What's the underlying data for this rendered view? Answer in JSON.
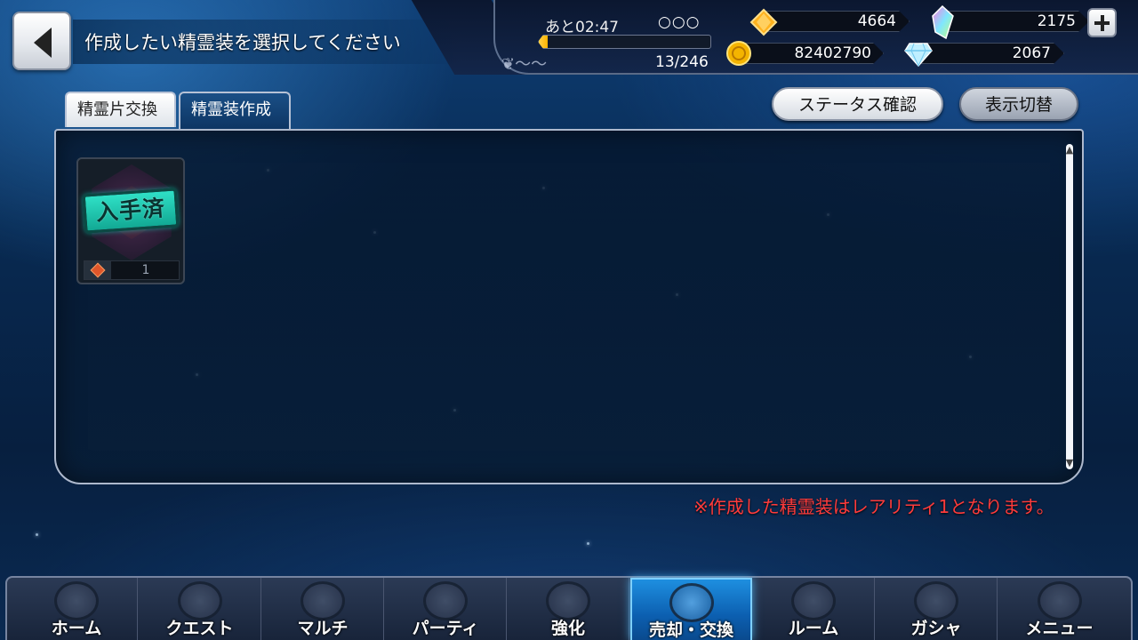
{
  "header": {
    "title": "作成したい精霊装を選択してください",
    "timer": "あと02:47",
    "circles": "○○○",
    "stamina_text": "13/246",
    "stamina_fraction": 0.053,
    "resources": {
      "gem_orange": "4664",
      "crystal_rainbow": "2175",
      "gold_coin": "82402790",
      "diamond": "2067"
    }
  },
  "tabs": [
    {
      "label": "精霊片交換",
      "active": false
    },
    {
      "label": "精霊装作成",
      "active": true
    }
  ],
  "buttons": {
    "status_check": "ステータス確認",
    "display_toggle": "表示切替"
  },
  "items": [
    {
      "stamp": "入手済",
      "count": "1"
    }
  ],
  "note": "※作成した精霊装はレアリティ1となります。",
  "nav": [
    {
      "label": "ホーム",
      "icon": "home-icon"
    },
    {
      "label": "クエスト",
      "icon": "quest-icon"
    },
    {
      "label": "マルチ",
      "icon": "multi-icon"
    },
    {
      "label": "パーティ",
      "icon": "party-icon"
    },
    {
      "label": "強化",
      "icon": "enhance-icon"
    },
    {
      "label": "売却・交換",
      "icon": "sell-exchange-icon",
      "active": true
    },
    {
      "label": "ルーム",
      "icon": "room-icon"
    },
    {
      "label": "ガシャ",
      "icon": "gacha-icon"
    },
    {
      "label": "メニュー",
      "icon": "menu-icon"
    }
  ],
  "colors": {
    "note_red": "#ff3b3b",
    "active_nav": "#1e8fe0",
    "stamp_teal": "#2fe0c6"
  }
}
